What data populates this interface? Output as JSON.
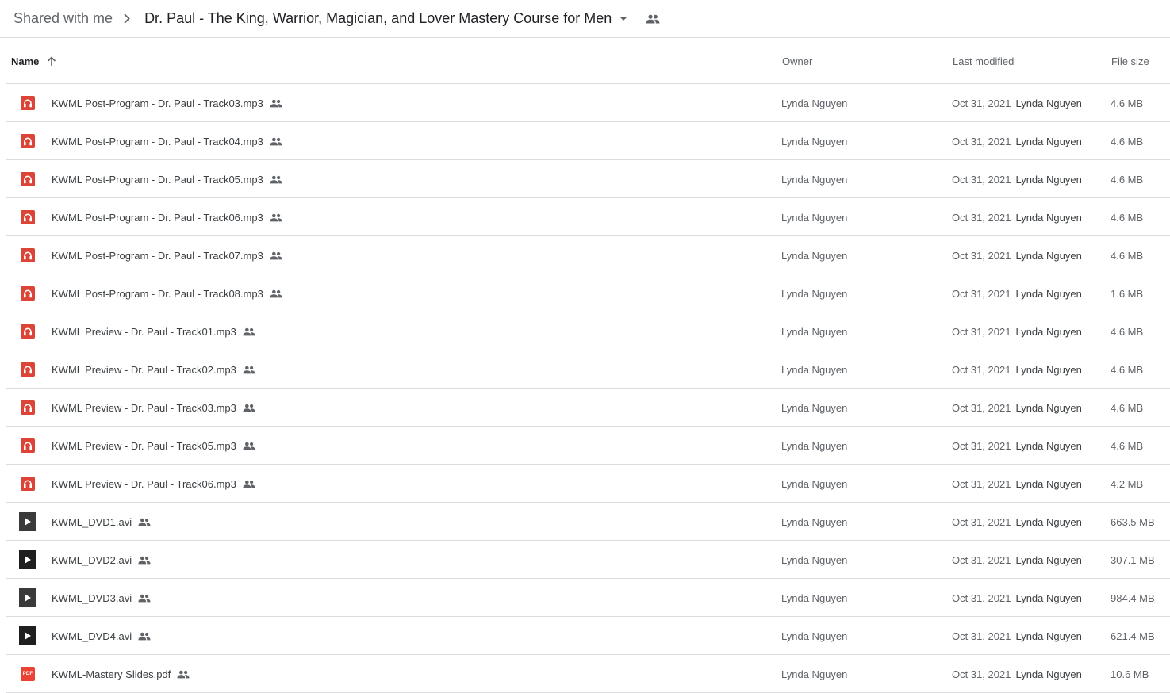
{
  "breadcrumb": {
    "root": "Shared with me",
    "current": "Dr. Paul - The King, Warrior, Magician, and Lover Mastery Course for Men"
  },
  "columns": {
    "name": "Name",
    "owner": "Owner",
    "modified": "Last modified",
    "size": "File size"
  },
  "files": [
    {
      "name": "KWML Post-Program - Dr. Paul - Track03.mp3",
      "type": "audio",
      "owner": "Lynda Nguyen",
      "modified": "Oct 31, 2021",
      "modified_by": "Lynda Nguyen",
      "size": "4.6 MB"
    },
    {
      "name": "KWML Post-Program - Dr. Paul - Track04.mp3",
      "type": "audio",
      "owner": "Lynda Nguyen",
      "modified": "Oct 31, 2021",
      "modified_by": "Lynda Nguyen",
      "size": "4.6 MB"
    },
    {
      "name": "KWML Post-Program - Dr. Paul - Track05.mp3",
      "type": "audio",
      "owner": "Lynda Nguyen",
      "modified": "Oct 31, 2021",
      "modified_by": "Lynda Nguyen",
      "size": "4.6 MB"
    },
    {
      "name": "KWML Post-Program - Dr. Paul - Track06.mp3",
      "type": "audio",
      "owner": "Lynda Nguyen",
      "modified": "Oct 31, 2021",
      "modified_by": "Lynda Nguyen",
      "size": "4.6 MB"
    },
    {
      "name": "KWML Post-Program - Dr. Paul - Track07.mp3",
      "type": "audio",
      "owner": "Lynda Nguyen",
      "modified": "Oct 31, 2021",
      "modified_by": "Lynda Nguyen",
      "size": "4.6 MB"
    },
    {
      "name": "KWML Post-Program - Dr. Paul - Track08.mp3",
      "type": "audio",
      "owner": "Lynda Nguyen",
      "modified": "Oct 31, 2021",
      "modified_by": "Lynda Nguyen",
      "size": "1.6 MB"
    },
    {
      "name": "KWML Preview - Dr. Paul - Track01.mp3",
      "type": "audio",
      "owner": "Lynda Nguyen",
      "modified": "Oct 31, 2021",
      "modified_by": "Lynda Nguyen",
      "size": "4.6 MB"
    },
    {
      "name": "KWML Preview - Dr. Paul - Track02.mp3",
      "type": "audio",
      "owner": "Lynda Nguyen",
      "modified": "Oct 31, 2021",
      "modified_by": "Lynda Nguyen",
      "size": "4.6 MB"
    },
    {
      "name": "KWML Preview - Dr. Paul - Track03.mp3",
      "type": "audio",
      "owner": "Lynda Nguyen",
      "modified": "Oct 31, 2021",
      "modified_by": "Lynda Nguyen",
      "size": "4.6 MB"
    },
    {
      "name": "KWML Preview - Dr. Paul - Track05.mp3",
      "type": "audio",
      "owner": "Lynda Nguyen",
      "modified": "Oct 31, 2021",
      "modified_by": "Lynda Nguyen",
      "size": "4.6 MB"
    },
    {
      "name": "KWML Preview - Dr. Paul - Track06.mp3",
      "type": "audio",
      "owner": "Lynda Nguyen",
      "modified": "Oct 31, 2021",
      "modified_by": "Lynda Nguyen",
      "size": "4.2 MB"
    },
    {
      "name": "KWML_DVD1.avi",
      "type": "video",
      "owner": "Lynda Nguyen",
      "modified": "Oct 31, 2021",
      "modified_by": "Lynda Nguyen",
      "size": "663.5 MB"
    },
    {
      "name": "KWML_DVD2.avi",
      "type": "video",
      "owner": "Lynda Nguyen",
      "modified": "Oct 31, 2021",
      "modified_by": "Lynda Nguyen",
      "size": "307.1 MB"
    },
    {
      "name": "KWML_DVD3.avi",
      "type": "video",
      "owner": "Lynda Nguyen",
      "modified": "Oct 31, 2021",
      "modified_by": "Lynda Nguyen",
      "size": "984.4 MB"
    },
    {
      "name": "KWML_DVD4.avi",
      "type": "video",
      "owner": "Lynda Nguyen",
      "modified": "Oct 31, 2021",
      "modified_by": "Lynda Nguyen",
      "size": "621.4 MB"
    },
    {
      "name": "KWML-Mastery Slides.pdf",
      "type": "pdf",
      "owner": "Lynda Nguyen",
      "modified": "Oct 31, 2021",
      "modified_by": "Lynda Nguyen",
      "size": "10.6 MB"
    }
  ],
  "icons": {
    "audio": "headphones-icon",
    "video": "video-play-icon",
    "pdf": "pdf-icon",
    "pdf_label": "PDF",
    "shared": "shared-people-icon",
    "sort": "arrow-up-icon"
  },
  "colors": {
    "audio": "#db4437",
    "pdf": "#ea4335",
    "divider": "#dadce0"
  }
}
